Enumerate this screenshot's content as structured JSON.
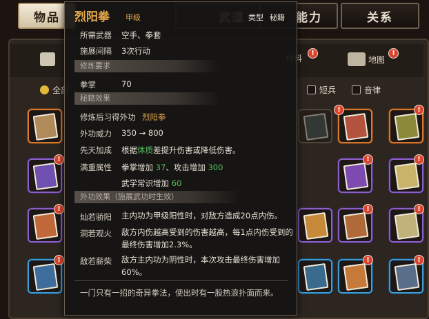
{
  "top_tabs": [
    {
      "label": "物品",
      "active": true
    },
    {
      "label": "武道",
      "active": false
    },
    {
      "label": "能力",
      "active": false
    },
    {
      "label": "关系",
      "active": false
    }
  ],
  "categories": [
    {
      "label": "材料",
      "badge": "!"
    },
    {
      "label": "地图",
      "badge": "!"
    }
  ],
  "filters": [
    {
      "label": "全部",
      "checked": true
    },
    {
      "label": "短兵",
      "checked": false
    },
    {
      "label": "音律",
      "checked": false
    }
  ],
  "tooltip": {
    "name": "烈阳拳",
    "grade": "甲级",
    "type_label": "类型",
    "type_value": "秘籍",
    "weapon_label": "所需武器",
    "weapon_value": "空手、拳套",
    "interval_label": "施展间隔",
    "interval_value": "3次行动",
    "section_requirements": "修炼要求",
    "req_label": "拳掌",
    "req_value": "70",
    "section_effects": "秘籍效果",
    "learn_label": "修炼后习得外功",
    "learn_value": "烈阳拳",
    "power_label": "外功威力",
    "power_value": "350 → 800",
    "innate_label": "先天加成",
    "innate_prefix": "根据",
    "innate_highlight": "体质",
    "innate_suffix": "差提升伤害或降低伤害。",
    "full_label": "满重属性",
    "full_line1_a": "拳掌增加 ",
    "full_line1_b": "37",
    "full_line1_c": "、攻击增加 ",
    "full_line1_d": "300",
    "full_line2_a": "武学常识增加 ",
    "full_line2_b": "60",
    "section_external": "外功效果（施展武功时生效）",
    "effects": [
      {
        "name": "灿若骄阳",
        "text": "主内功为甲级阳性时，对敌方造成20点内伤。"
      },
      {
        "name": "洞若观火",
        "text": "敌方内伤越高受到的伤害越高，每1点内伤受到的最终伤害增加2.3%。"
      },
      {
        "name": "敌若薪柴",
        "text": "敌方主内功为阴性时，本次攻击最终伤害增加60%。"
      }
    ],
    "flavor": "一门只有一招的奇异拳法，使出时有一股热浪扑面而来。"
  },
  "colors": {
    "title_gold": "#e7a84b",
    "value_green": "#56c05a",
    "rarity_orange": "#d7782e",
    "rarity_purple": "#8d5fc8",
    "rarity_blue": "#3d9bd6"
  }
}
